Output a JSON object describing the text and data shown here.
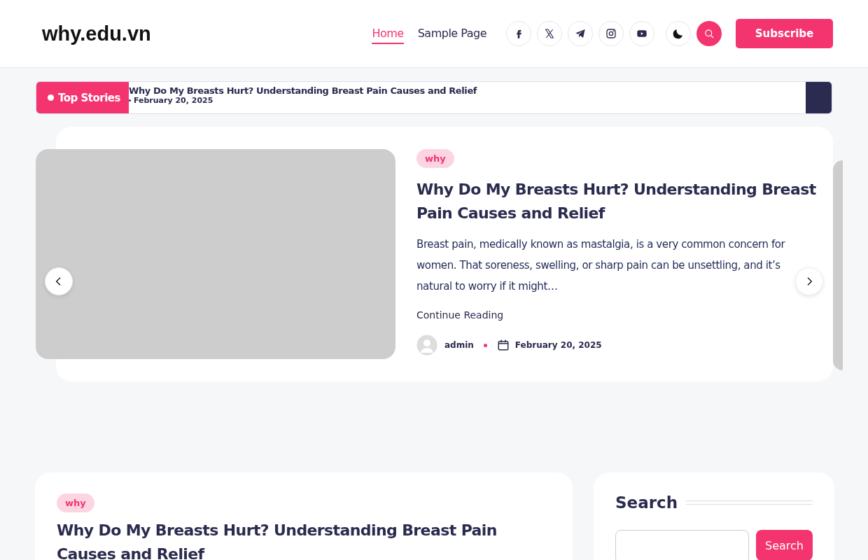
{
  "site": {
    "logo": "why.edu.vn"
  },
  "nav": [
    {
      "label": "Home",
      "selected": true
    },
    {
      "label": "Sample Page",
      "selected": false
    }
  ],
  "social": [
    {
      "kind": "facebook"
    },
    {
      "kind": "x"
    },
    {
      "kind": "telegram"
    },
    {
      "kind": "instagram"
    },
    {
      "kind": "youtube"
    }
  ],
  "dark_mode": {
    "on": false
  },
  "subscribe": "Subscribe",
  "ticker": {
    "label": "Top Stories",
    "title": "Why Do My Breasts Hurt? Understanding Breast Pain Causes and Relief",
    "date": "February 20, 2025"
  },
  "slide": {
    "category": "why",
    "title": "Why Do My Breasts Hurt? Understanding Breast Pain Causes and Relief",
    "excerpt": "Breast pain, medically known as mastalgia, is a very common concern for women. That soreness, swelling, or sharp pain can be unsettling, and it’s natural to worry if it might…",
    "link": "Continue Reading",
    "author": "admin",
    "date": "February 20, 2025"
  },
  "post": {
    "category": "why",
    "title": "Why Do My Breasts Hurt? Understanding Breast Pain Causes and Relief"
  },
  "sidebar": {
    "title": "Search",
    "button": "Search"
  }
}
